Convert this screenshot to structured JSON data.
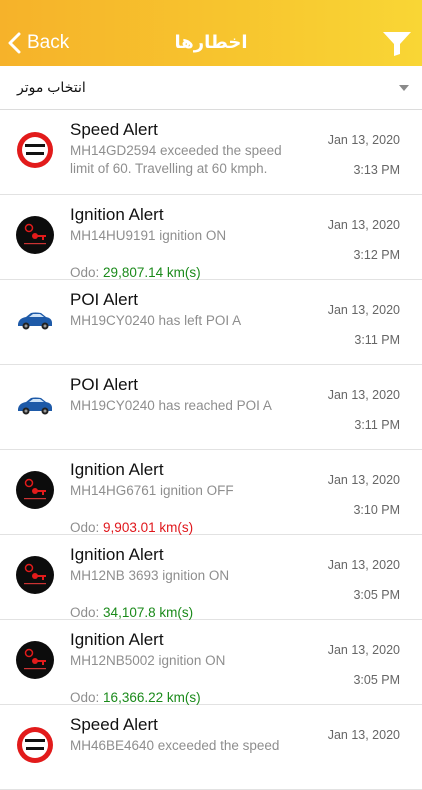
{
  "nav": {
    "back_label": "Back",
    "title": "اخطارها"
  },
  "selector": {
    "label": "انتخاب موتر"
  },
  "colors": {
    "nav_start": "#f6b22a",
    "nav_end": "#f9d635",
    "odo_green": "#1a8a1a",
    "odo_red": "#e0161b"
  },
  "alerts": [
    {
      "icon": "speed-limit-icon",
      "title": "Speed Alert",
      "line1": "MH14GD2594 exceeded the speed",
      "line2": "limit of 60. Travelling at 60 kmph.",
      "date": "Jan 13, 2020",
      "time": "3:13 PM"
    },
    {
      "icon": "ignition-key-icon",
      "title": "Ignition Alert",
      "line1": "MH14HU9191 ignition ON",
      "odo_label": "Odo:",
      "odo_value": "29,807.14 km(s)",
      "odo_color": "green",
      "date": "Jan 13, 2020",
      "time": "3:12 PM"
    },
    {
      "icon": "car-icon",
      "title": "POI Alert",
      "line1": "MH19CY0240 has left POI A",
      "date": "Jan 13, 2020",
      "time": "3:11 PM"
    },
    {
      "icon": "car-icon",
      "title": "POI Alert",
      "line1": "MH19CY0240 has reached POI A",
      "date": "Jan 13, 2020",
      "time": "3:11 PM"
    },
    {
      "icon": "ignition-key-icon",
      "title": "Ignition Alert",
      "line1": "MH14HG6761 ignition OFF",
      "odo_label": "Odo:",
      "odo_value": "9,903.01 km(s)",
      "odo_color": "red",
      "date": "Jan 13, 2020",
      "time": "3:10 PM"
    },
    {
      "icon": "ignition-key-icon",
      "title": "Ignition Alert",
      "line1": "MH12NB 3693 ignition ON",
      "odo_label": "Odo:",
      "odo_value": "34,107.8 km(s)",
      "odo_color": "green",
      "date": "Jan 13, 2020",
      "time": "3:05 PM"
    },
    {
      "icon": "ignition-key-icon",
      "title": "Ignition Alert",
      "line1": "MH12NB5002 ignition ON",
      "odo_label": "Odo:",
      "odo_value": "16,366.22 km(s)",
      "odo_color": "green",
      "date": "Jan 13, 2020",
      "time": "3:05 PM"
    },
    {
      "icon": "speed-limit-icon",
      "title": "Speed Alert",
      "line1": "MH46BE4640 exceeded the speed",
      "date": "Jan 13, 2020",
      "time": ""
    }
  ]
}
